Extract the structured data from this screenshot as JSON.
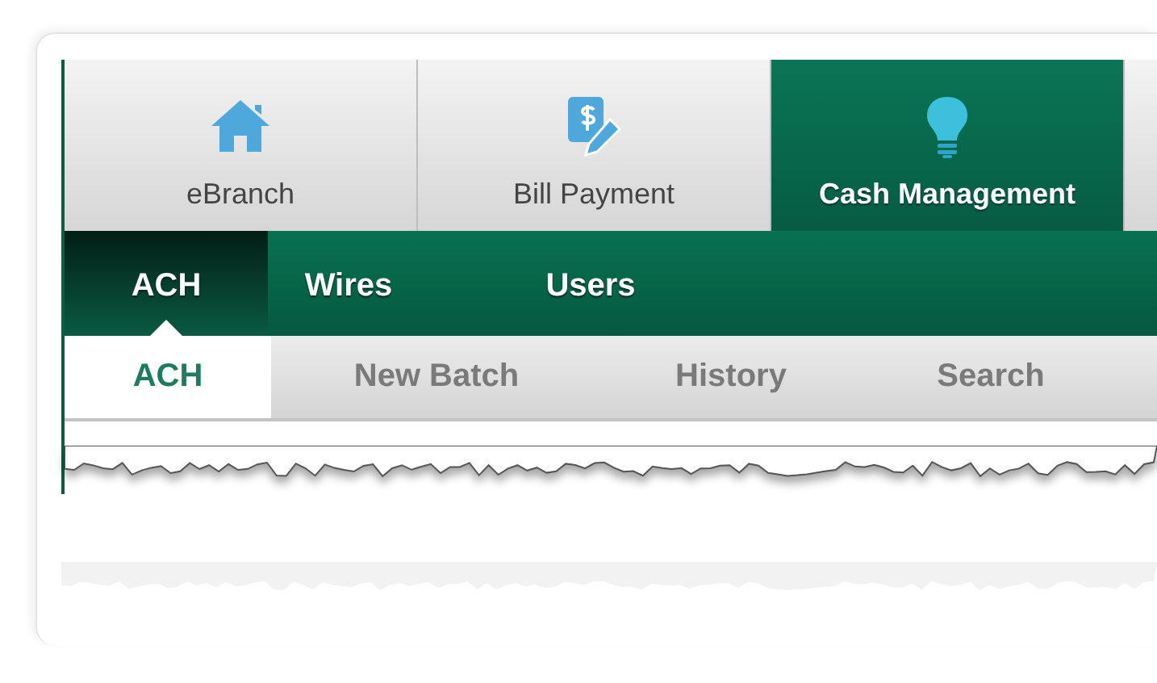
{
  "main_tabs": [
    {
      "label": "eBranch",
      "kind": "house",
      "selected": false
    },
    {
      "label": "Bill Payment",
      "kind": "bill",
      "selected": false
    },
    {
      "label": "Cash Management",
      "kind": "bulb",
      "selected": true
    }
  ],
  "sub_tabs": [
    {
      "label": "ACH",
      "selected": true
    },
    {
      "label": "Wires",
      "selected": false
    },
    {
      "label": "Users",
      "selected": false
    }
  ],
  "section_tabs": [
    {
      "label": "ACH",
      "selected": true
    },
    {
      "label": "New Batch",
      "selected": false
    },
    {
      "label": "History",
      "selected": false
    },
    {
      "label": "Search",
      "selected": false
    }
  ]
}
